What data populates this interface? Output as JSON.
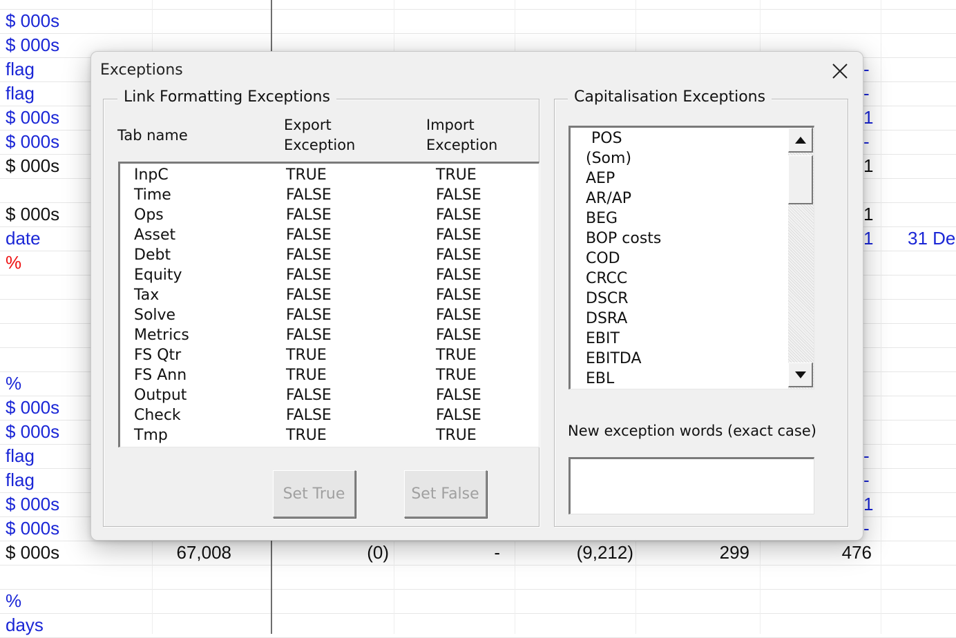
{
  "sheet": {
    "units": [
      {
        "text": "$ 000s",
        "color": "blue"
      },
      {
        "text": "$ 000s",
        "color": "blue"
      },
      {
        "text": "flag",
        "color": "blue"
      },
      {
        "text": "flag",
        "color": "blue"
      },
      {
        "text": "$ 000s",
        "color": "blue"
      },
      {
        "text": "$ 000s",
        "color": "blue"
      },
      {
        "text": "$ 000s",
        "color": "black"
      },
      {
        "text": "",
        "color": "black"
      },
      {
        "text": "$ 000s",
        "color": "black"
      },
      {
        "text": "date",
        "color": "blue"
      },
      {
        "text": "%",
        "color": "red"
      },
      {
        "text": "",
        "color": "black"
      },
      {
        "text": "",
        "color": "black"
      },
      {
        "text": "",
        "color": "black"
      },
      {
        "text": "",
        "color": "black"
      },
      {
        "text": "%",
        "color": "blue"
      },
      {
        "text": "$ 000s",
        "color": "blue"
      },
      {
        "text": "$ 000s",
        "color": "blue"
      },
      {
        "text": "flag",
        "color": "blue"
      },
      {
        "text": "flag",
        "color": "blue"
      },
      {
        "text": "$ 000s",
        "color": "blue"
      },
      {
        "text": "$ 000s",
        "color": "blue"
      },
      {
        "text": "$ 000s",
        "color": "black"
      },
      {
        "text": "",
        "color": "black"
      },
      {
        "text": "%",
        "color": "blue"
      },
      {
        "text": "days",
        "color": "blue"
      }
    ],
    "right_fragments": [
      {
        "text": "-",
        "color": "blue"
      },
      {
        "text": "-",
        "color": "blue"
      },
      {
        "text": "1",
        "color": "blue"
      },
      {
        "text": "-",
        "color": "blue"
      },
      {
        "text": "1",
        "color": "black"
      },
      {
        "text": "1",
        "color": "black"
      },
      {
        "text": "1",
        "color": "blue"
      },
      {
        "text": "-",
        "color": "blue"
      },
      {
        "text": "-",
        "color": "blue"
      },
      {
        "text": "1",
        "color": "blue"
      },
      {
        "text": "-",
        "color": "blue"
      }
    ],
    "date_fragment": "31 De",
    "totals_row": [
      "67,008",
      "(0)",
      "-",
      "(9,212)",
      "299",
      "476"
    ]
  },
  "dialog": {
    "title": "Exceptions",
    "link_group": {
      "legend": "Link Formatting Exceptions",
      "col_tab": "Tab name",
      "col_export_1": "Export",
      "col_export_2": "Exception",
      "col_import_1": "Import",
      "col_import_2": "Exception",
      "rows": [
        {
          "tab": "InpC",
          "export": "TRUE",
          "import": "TRUE"
        },
        {
          "tab": "Time",
          "export": "FALSE",
          "import": "FALSE"
        },
        {
          "tab": "Ops",
          "export": "FALSE",
          "import": "FALSE"
        },
        {
          "tab": "Asset",
          "export": "FALSE",
          "import": "FALSE"
        },
        {
          "tab": "Debt",
          "export": "FALSE",
          "import": "FALSE"
        },
        {
          "tab": "Equity",
          "export": "FALSE",
          "import": "FALSE"
        },
        {
          "tab": "Tax",
          "export": "FALSE",
          "import": "FALSE"
        },
        {
          "tab": "Solve",
          "export": "FALSE",
          "import": "FALSE"
        },
        {
          "tab": "Metrics",
          "export": "FALSE",
          "import": "FALSE"
        },
        {
          "tab": "FS Qtr",
          "export": "TRUE",
          "import": "TRUE"
        },
        {
          "tab": "FS Ann",
          "export": "TRUE",
          "import": "TRUE"
        },
        {
          "tab": "Output",
          "export": "FALSE",
          "import": "FALSE"
        },
        {
          "tab": "Check",
          "export": "FALSE",
          "import": "FALSE"
        },
        {
          "tab": "Tmp",
          "export": "TRUE",
          "import": "TRUE"
        }
      ],
      "set_true_label": "Set True",
      "set_false_label": "Set False"
    },
    "cap_group": {
      "legend": "Capitalisation Exceptions",
      "items": [
        "POS",
        "(Som)",
        "AEP",
        "AR/AP",
        "BEG",
        "BOP costs",
        "COD",
        "CRCC",
        "DSCR",
        "DSRA",
        "EBIT",
        "EBITDA",
        "EBL"
      ],
      "new_words_label": "New exception words (exact case)",
      "new_words_value": ""
    }
  }
}
